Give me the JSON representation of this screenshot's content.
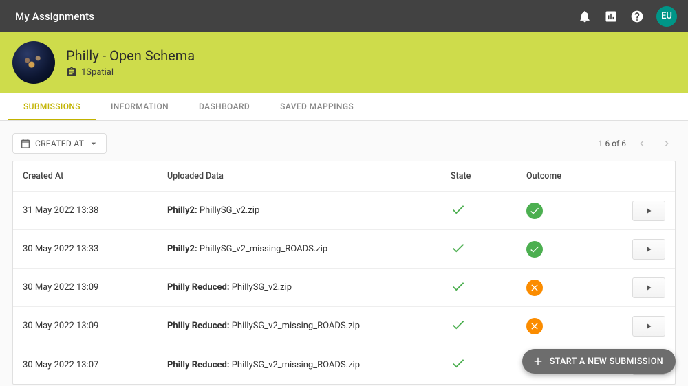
{
  "appbar": {
    "title": "My Assignments",
    "avatar_initials": "EU"
  },
  "header": {
    "title": "Philly - Open Schema",
    "subtitle": "1Spatial"
  },
  "tabs": [
    {
      "label": "SUBMISSIONS",
      "active": true
    },
    {
      "label": "INFORMATION",
      "active": false
    },
    {
      "label": "DASHBOARD",
      "active": false
    },
    {
      "label": "SAVED MAPPINGS",
      "active": false
    }
  ],
  "toolbar": {
    "sort_label": "CREATED AT",
    "pagination_label": "1-6 of 6"
  },
  "columns": {
    "created_at": "Created At",
    "uploaded_data": "Uploaded Data",
    "state": "State",
    "outcome": "Outcome"
  },
  "rows": [
    {
      "created_at": "31 May 2022 13:38",
      "dataset": "Philly2:",
      "file": "PhillySG_v2.zip",
      "state": "done",
      "outcome": "pass"
    },
    {
      "created_at": "30 May 2022 13:33",
      "dataset": "Philly2:",
      "file": "PhillySG_v2_missing_ROADS.zip",
      "state": "done",
      "outcome": "pass"
    },
    {
      "created_at": "30 May 2022 13:09",
      "dataset": "Philly Reduced:",
      "file": "PhillySG_v2.zip",
      "state": "done",
      "outcome": "fail"
    },
    {
      "created_at": "30 May 2022 13:09",
      "dataset": "Philly Reduced:",
      "file": "PhillySG_v2_missing_ROADS.zip",
      "state": "done",
      "outcome": "fail"
    },
    {
      "created_at": "30 May 2022 13:07",
      "dataset": "Philly Reduced:",
      "file": "PhillySG_v2_missing_ROADS.zip",
      "state": "done",
      "outcome": "fail"
    }
  ],
  "fab": {
    "label": "START A NEW SUBMISSION"
  }
}
